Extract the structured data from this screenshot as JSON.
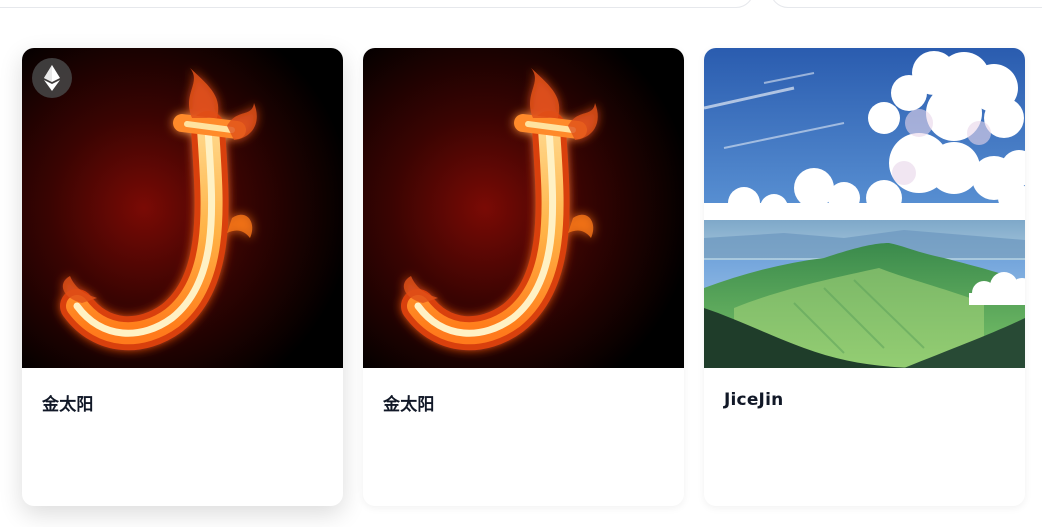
{
  "cards": [
    {
      "title": "金太阳",
      "image": "flaming-letter-j",
      "chain_icon": "ethereum-icon",
      "show_chain_badge": true
    },
    {
      "title": "金太阳",
      "image": "flaming-letter-j",
      "show_chain_badge": false
    },
    {
      "title": "JiceJin",
      "image": "anime-mountain-landscape",
      "show_chain_badge": false
    }
  ],
  "colors": {
    "title_text": "#111827",
    "card_bg": "#ffffff",
    "fire_core": "#ffd27a",
    "fire_outer": "#e0501a",
    "sky_top": "#2f66b8",
    "mountain_green": "#3f9a55"
  }
}
